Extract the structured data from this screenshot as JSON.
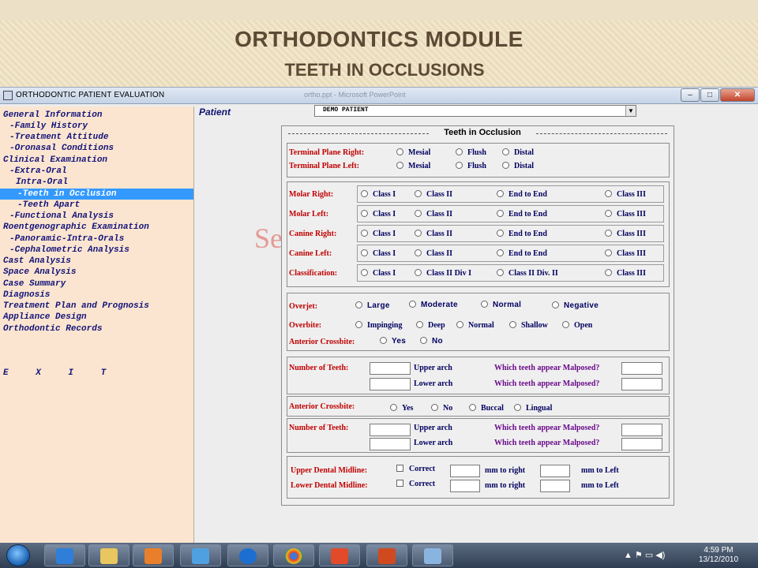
{
  "slide": {
    "title": "ORTHODONTICS MODULE",
    "subtitle": "TEETH IN OCCLUSIONS"
  },
  "window": {
    "title": "ORTHODONTIC PATIENT EVALUATION",
    "ghost_title": "ortho.ppt - Microsoft PowerPoint",
    "min": "–",
    "max": "□",
    "close": "✕"
  },
  "nav": [
    "General Information",
    "-Family History",
    "-Treatment Attitude",
    "-Oronasal Conditions",
    "Clinical Examination",
    "-Extra-Oral",
    "Intra-Oral",
    "-Teeth in Occlusion",
    "-Teeth Apart",
    "-Functional Analysis",
    "Roentgenographic Examination",
    "-Panoramic-Intra-Orals",
    "-Cephalometric Analysis",
    "Cast Analysis",
    "Space Analysis",
    "Case Summary",
    "Diagnosis",
    "Treatment Plan and Prognosis",
    "Appliance Design",
    "Orthodontic Records",
    "E X I T"
  ],
  "patient": {
    "label": "Patient",
    "value": "DEMO PATIENT"
  },
  "bg_text": "Se",
  "form": {
    "header": "Teeth in Occlusion",
    "terminal": {
      "right_label": "Terminal Plane Right:",
      "left_label": "Terminal Plane Left:",
      "options": [
        "Mesial",
        "Flush",
        "Distal"
      ]
    },
    "molar": {
      "rows": [
        {
          "label": "Molar Right:",
          "options": [
            "Class I",
            "Class II",
            "End to End",
            "Class III"
          ]
        },
        {
          "label": "Molar Left:",
          "options": [
            "Class I",
            "Class II",
            "End to End",
            "Class III"
          ]
        },
        {
          "label": "Canine Right:",
          "options": [
            "Class I",
            "Class II",
            "End to End",
            "Class III"
          ]
        },
        {
          "label": "Canine Left:",
          "options": [
            "Class I",
            "Class II",
            "End to End",
            "Class III"
          ]
        },
        {
          "label": "Classification:",
          "options": [
            "Class I",
            "Class II Div I",
            "Class II Div. II",
            "Class III"
          ]
        }
      ]
    },
    "overjet": {
      "label": "Overjet:",
      "options": [
        "Large",
        "Moderate",
        "Normal",
        "Negative"
      ]
    },
    "overbite": {
      "label": "Overbite:",
      "options": [
        "Impinging",
        "Deep",
        "Normal",
        "Shallow",
        "Open"
      ]
    },
    "anterior1": {
      "label": "Anterior Crossbite:",
      "options": [
        "Yes",
        "No"
      ]
    },
    "teeth1": {
      "label": "Number of Teeth:",
      "upper": "Upper arch",
      "lower": "Lower arch",
      "malposed": "Which teeth appear Malposed?"
    },
    "anterior2": {
      "label": "Anterior Crossbite:",
      "options": [
        "Yes",
        "No",
        "Buccal",
        "Lingual"
      ]
    },
    "teeth2": {
      "label": "Number of Teeth:",
      "upper": "Upper arch",
      "lower": "Lower arch",
      "malposed": "Which teeth appear Malposed?"
    },
    "midline": {
      "upper_label": "Upper Dental Midline:",
      "lower_label": "Lower Dental Midline:",
      "correct": "Correct",
      "right": "mm to right",
      "left": "mm to Left"
    }
  },
  "taskbar": {
    "time": "4:59 PM",
    "date": "13/12/2010",
    "tray": "▲  ⚑  ▭  ◀)"
  }
}
